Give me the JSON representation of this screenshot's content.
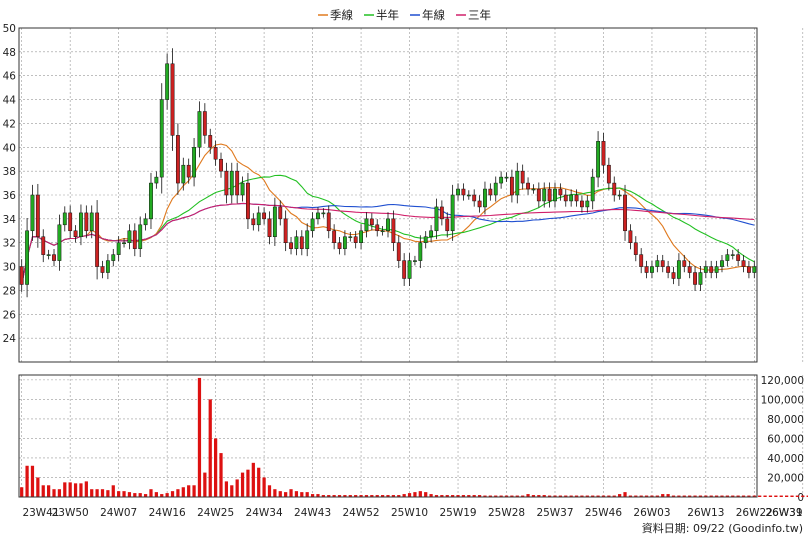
{
  "chart_data": {
    "type": "candlestick",
    "legend": [
      {
        "name": "季線",
        "color": "#e07a1f"
      },
      {
        "name": "半年",
        "color": "#22c022"
      },
      {
        "name": "年線",
        "color": "#1f4fd0"
      },
      {
        "name": "三年",
        "color": "#d0206a"
      }
    ],
    "price_axis": {
      "min": 22,
      "max": 50,
      "ticks": [
        24,
        26,
        28,
        30,
        32,
        34,
        36,
        38,
        40,
        42,
        44,
        46,
        48,
        50
      ]
    },
    "volume_axis": {
      "min": 0,
      "max": 125000,
      "ticks": [
        0,
        20000,
        40000,
        60000,
        80000,
        100000,
        120000
      ],
      "tick_labels": [
        "0",
        "20,000",
        "40,000",
        "60,000",
        "80,000",
        "100,000",
        "120,000"
      ]
    },
    "x_labels": [
      "23W41",
      "23W50",
      "24W07",
      "24W16",
      "24W25",
      "24W34",
      "24W43",
      "24W52",
      "25W10",
      "25W19",
      "25W28",
      "25W37",
      "25W46",
      "26W03",
      "26W13",
      "26W22",
      "26W31",
      "26W39"
    ],
    "x_label_index": [
      0,
      9,
      18,
      27,
      36,
      45,
      54,
      63,
      72,
      81,
      90,
      99,
      108,
      117,
      127,
      136,
      145,
      153
    ],
    "closes": [
      28.5,
      33.0,
      36.0,
      32.5,
      31.0,
      31.0,
      30.5,
      33.5,
      34.5,
      33.0,
      32.5,
      34.5,
      33.0,
      34.5,
      30.0,
      29.5,
      30.5,
      31.0,
      32.0,
      32.0,
      33.0,
      31.5,
      33.5,
      34.0,
      37.0,
      37.5,
      44.0,
      47.0,
      41.0,
      37.0,
      38.5,
      37.5,
      40.0,
      43.0,
      41.0,
      40.0,
      39.0,
      38.0,
      36.0,
      38.0,
      36.0,
      37.0,
      34.0,
      33.5,
      34.5,
      34.0,
      32.5,
      35.0,
      34.0,
      32.0,
      31.5,
      32.5,
      31.5,
      33.0,
      34.0,
      34.5,
      34.5,
      33.0,
      32.0,
      31.5,
      32.5,
      32.5,
      32.0,
      33.0,
      34.0,
      33.5,
      33.0,
      33.0,
      34.0,
      32.0,
      30.5,
      29.0,
      30.5,
      30.5,
      32.0,
      32.5,
      33.0,
      35.0,
      34.0,
      33.0,
      36.0,
      36.5,
      36.0,
      36.0,
      35.5,
      35.0,
      36.5,
      36.0,
      37.0,
      37.5,
      37.5,
      36.0,
      38.0,
      37.0,
      36.5,
      36.5,
      35.5,
      36.5,
      35.5,
      36.5,
      36.0,
      35.5,
      36.0,
      35.5,
      35.0,
      35.5,
      37.5,
      40.5,
      38.5,
      37.0,
      36.0,
      36.0,
      33.0,
      32.0,
      31.0,
      30.0,
      29.5,
      30.0,
      30.5,
      30.0,
      29.5,
      29.0,
      30.5,
      30.0,
      29.5,
      28.5,
      29.5,
      30.0,
      29.5,
      30.0,
      30.5,
      31.0,
      31.0,
      30.5,
      30.0,
      29.5,
      30.0
    ],
    "price_note": "weekly candles; close values estimated from the price axis",
    "volume": [
      10000,
      32000,
      32000,
      20000,
      12000,
      12000,
      8000,
      8000,
      15000,
      15000,
      14000,
      14000,
      16000,
      8000,
      8000,
      8000,
      7000,
      12000,
      6000,
      6000,
      5000,
      4000,
      4000,
      3000,
      8000,
      5000,
      3000,
      4000,
      6000,
      8000,
      10000,
      12000,
      12000,
      122000,
      25000,
      100000,
      60000,
      45000,
      16000,
      12000,
      18000,
      25000,
      28000,
      35000,
      30000,
      20000,
      12000,
      8000,
      6000,
      5000,
      8000,
      6000,
      5000,
      5000,
      3000,
      3000,
      2000,
      2000,
      2000,
      2000,
      2000,
      2000,
      2000,
      2000,
      2000,
      2000,
      2000,
      2000,
      2000,
      2000,
      2000,
      3000,
      4000,
      5000,
      6000,
      5000,
      3000,
      2000,
      2000,
      2000,
      2000,
      2000,
      2000,
      2000,
      2000,
      2000,
      1500,
      1500,
      1500,
      1500,
      1500,
      1500,
      1500,
      1500,
      3000,
      2000,
      2000,
      2000,
      1500,
      1500,
      1500,
      1500,
      1500,
      1500,
      1500,
      1500,
      1500,
      1500,
      1500,
      1500,
      1500,
      3000,
      5000,
      1500,
      1500,
      1500,
      1500,
      1500,
      1500,
      3000,
      3000,
      1500,
      1500,
      1500,
      1500,
      1500,
      1500,
      1500,
      1500,
      1500,
      1500,
      1500,
      1500,
      1500,
      1500,
      1500,
      1500,
      1500,
      1500,
      1500,
      1500,
      1500,
      1500,
      1500,
      1500,
      1500,
      1500,
      1500,
      1500,
      1500,
      1500,
      1500,
      1500
    ],
    "volume_note": "weekly volume; bar heights estimated from the volume axis"
  },
  "source_label": "資料日期: 09/22 (Goodinfo.tw)",
  "colors": {
    "up": "#22aa22",
    "down": "#cc2222",
    "grid": "#999999",
    "frame": "#333333",
    "volume": "#dd1111"
  }
}
